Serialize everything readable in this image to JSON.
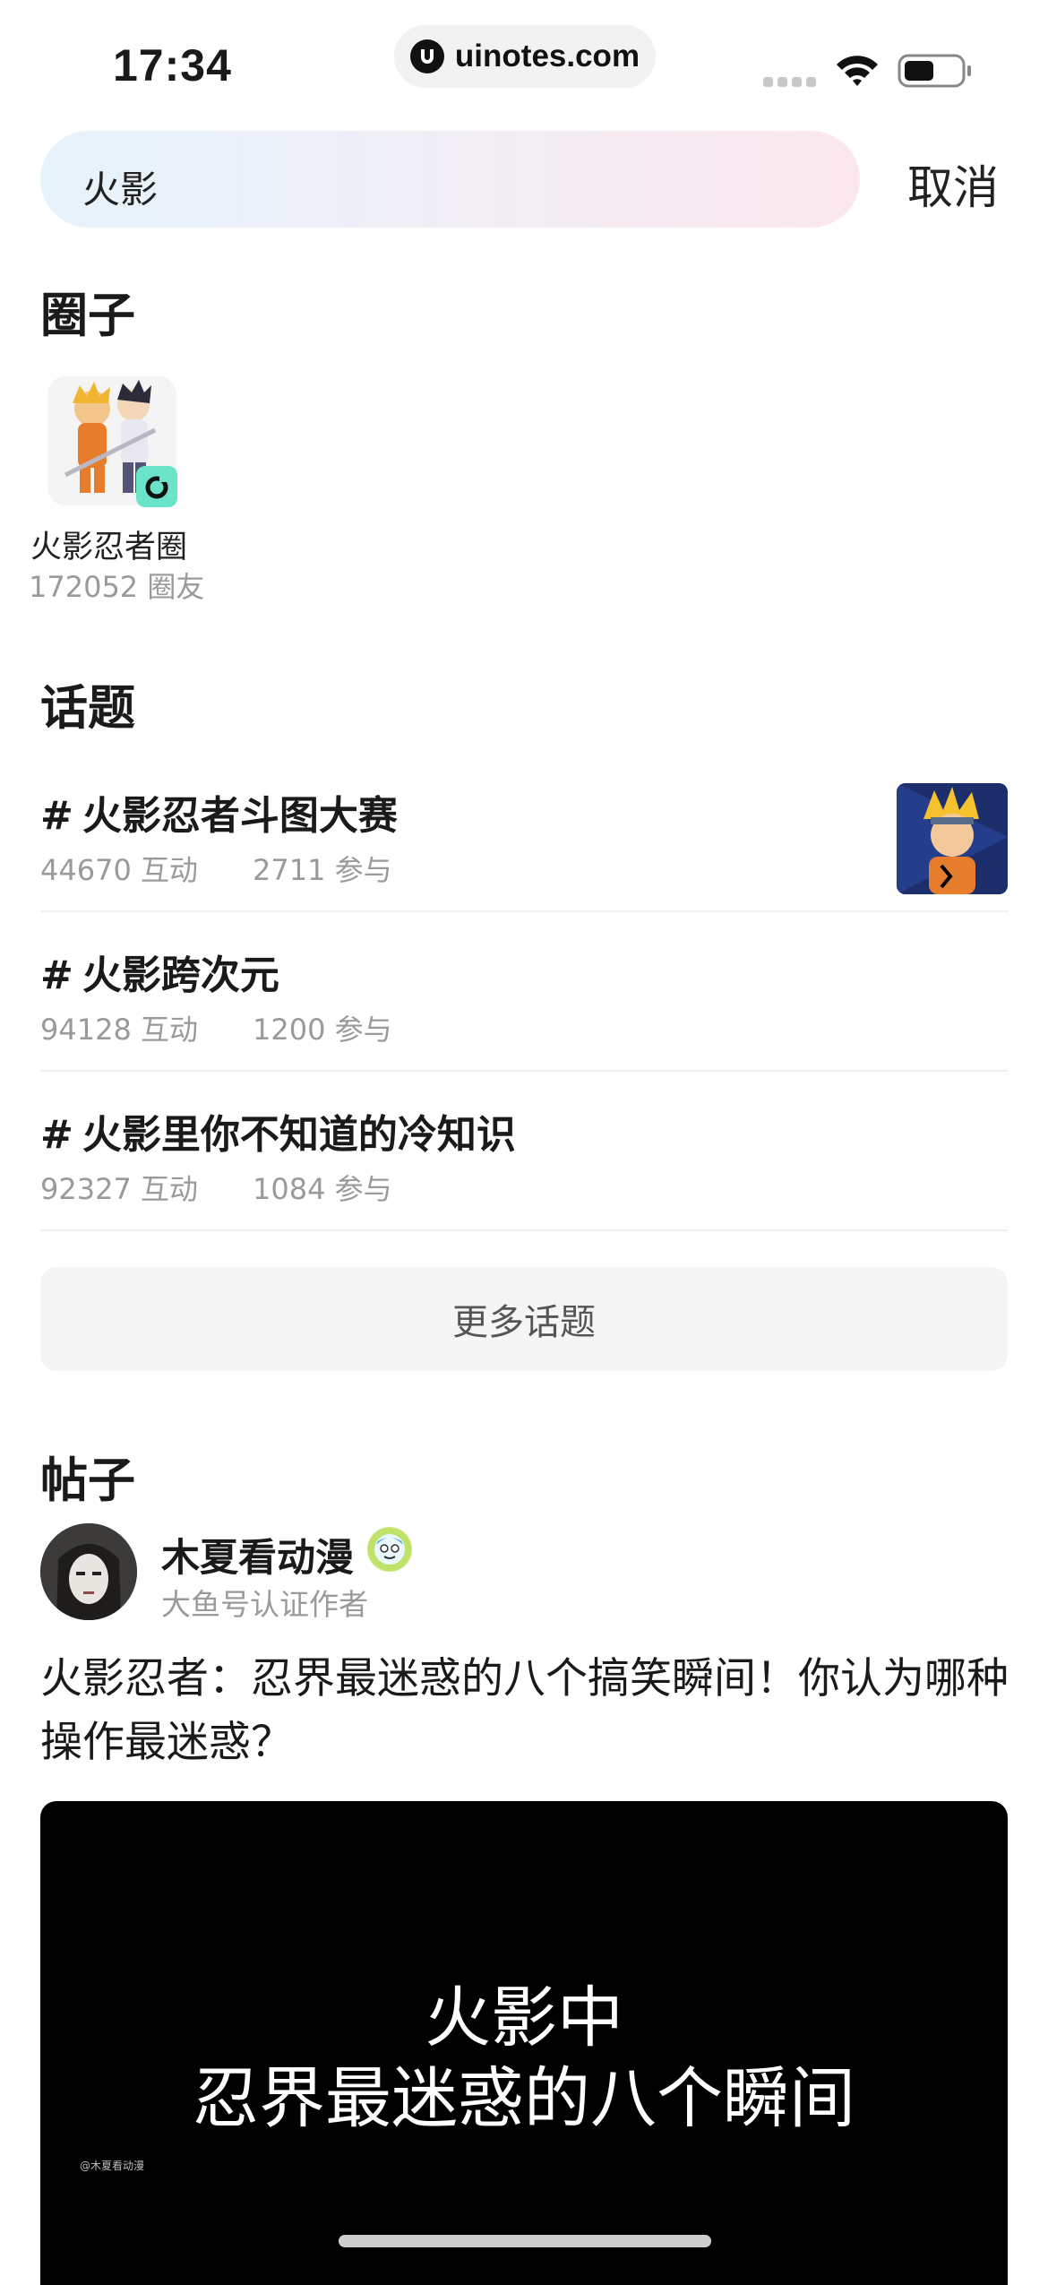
{
  "status_bar": {
    "time": "17:34",
    "url": "uinotes.com",
    "icons": [
      "signal-dots-icon",
      "wifi-icon",
      "battery-icon"
    ]
  },
  "search": {
    "query": "火影",
    "cancel_label": "取消"
  },
  "sections": {
    "circles_title": "圈子",
    "topics_title": "话题",
    "posts_title": "帖子"
  },
  "circle": {
    "name": "火影忍者圈",
    "members": "172052 圈友"
  },
  "topics": [
    {
      "hash": "#",
      "title": "火影忍者斗图大赛",
      "interactions": "44670 互动",
      "participants": "2711 参与",
      "has_thumb": true
    },
    {
      "hash": "#",
      "title": "火影跨次元",
      "interactions": "94128 互动",
      "participants": "1200 参与",
      "has_thumb": false
    },
    {
      "hash": "#",
      "title": "火影里你不知道的冷知识",
      "interactions": "92327 互动",
      "participants": "1084 参与",
      "has_thumb": false
    }
  ],
  "more_topics_label": "更多话题",
  "post": {
    "author": "木夏看动漫",
    "author_subtitle": "大鱼号认证作者",
    "text": "火影忍者：忍界最迷惑的八个搞笑瞬间！你认为哪种操作最迷惑？",
    "video": {
      "line1": "火影中",
      "line2": "忍界最迷惑的八个瞬间",
      "watermark": "@木夏看动漫"
    }
  },
  "colors": {
    "search_gradient_start": "#e6f3fb",
    "search_gradient_end": "#fbe8ee",
    "muted_text": "#9a9a9a",
    "badge_teal": "#6be3c8"
  }
}
